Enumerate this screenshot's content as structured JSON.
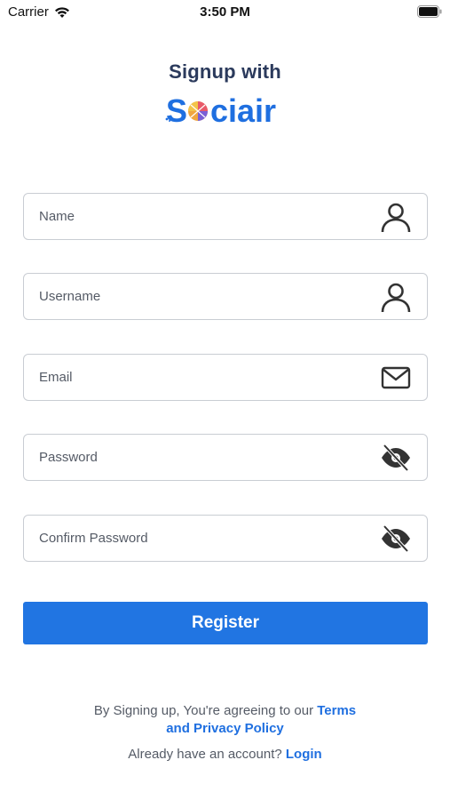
{
  "status_bar": {
    "carrier": "Carrier",
    "time": "3:50 PM"
  },
  "header": {
    "title": "Signup with",
    "logo_text": "Sociair",
    "brand_color": "#1f6fe0"
  },
  "form": {
    "name": {
      "placeholder": "Name",
      "icon": "person-icon"
    },
    "username": {
      "placeholder": "Username",
      "icon": "person-icon"
    },
    "email": {
      "placeholder": "Email",
      "icon": "envelope-icon"
    },
    "password": {
      "placeholder": "Password",
      "icon": "eye-off-icon"
    },
    "confirm_password": {
      "placeholder": "Confirm Password",
      "icon": "eye-off-icon"
    }
  },
  "register_button": {
    "label": "Register",
    "color": "#2175e2"
  },
  "terms": {
    "prefix": "By Signing up, You're agreeing to our ",
    "link_part1": "Terms",
    "link_part2": "and Privacy Policy"
  },
  "login": {
    "prompt": "Already have an account? ",
    "link": "Login"
  }
}
